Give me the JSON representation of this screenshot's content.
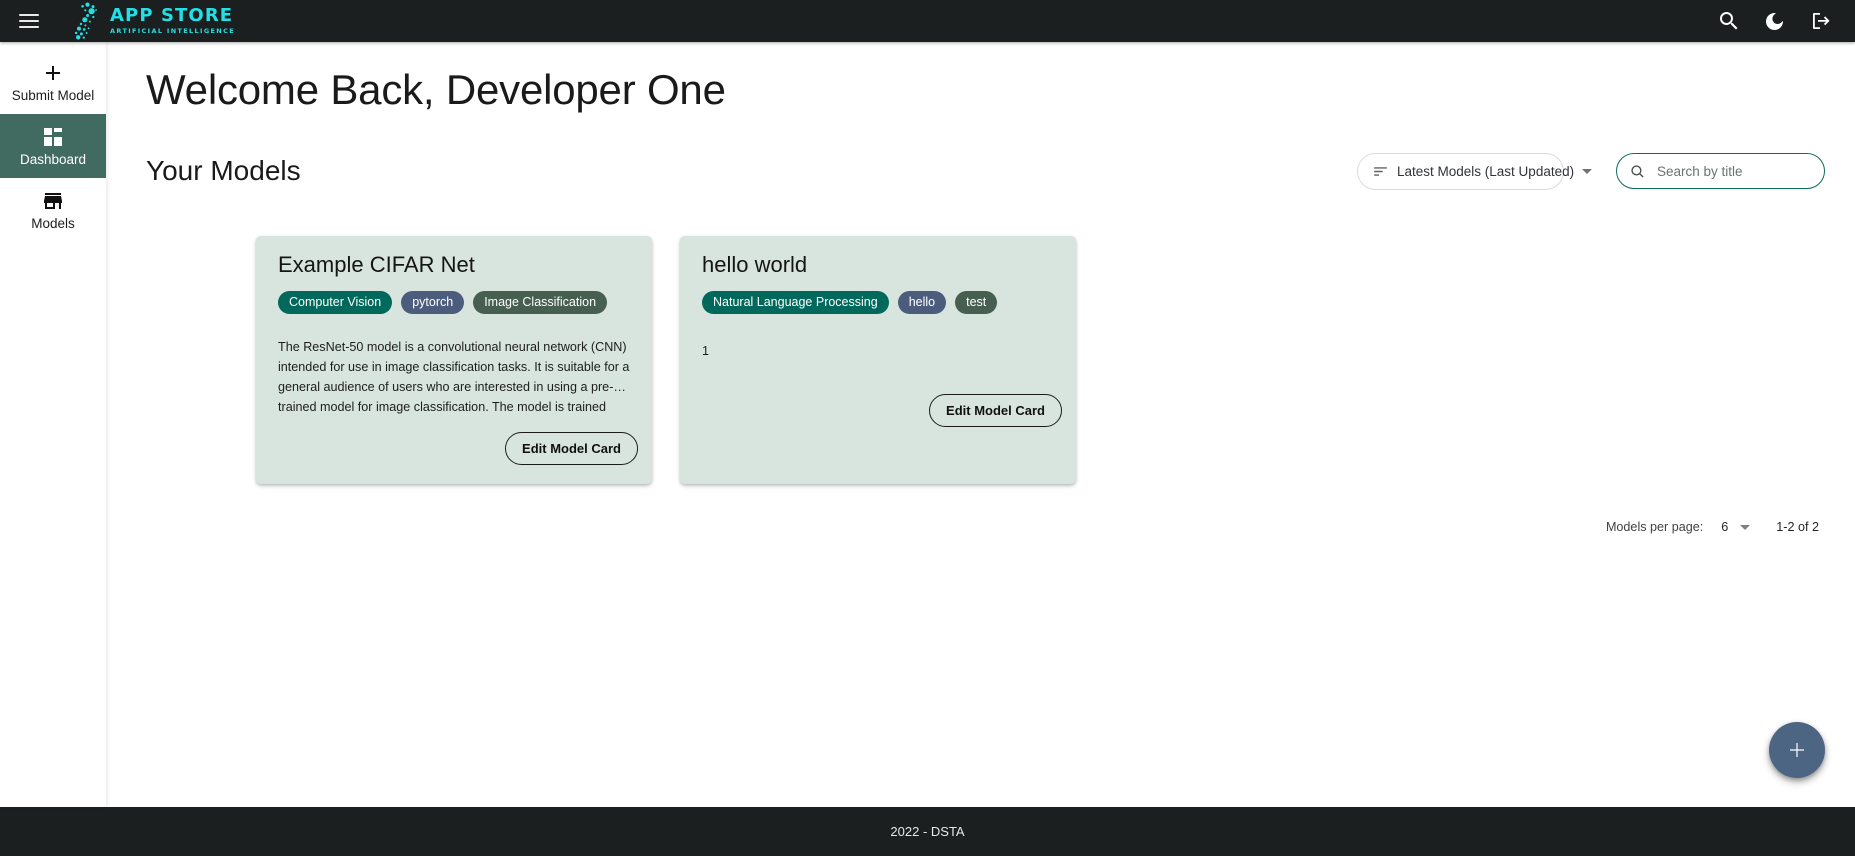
{
  "topbar": {
    "menu_icon": "hamburger-menu-icon",
    "logo": {
      "title": "APP STORE",
      "subtitle": "ARTIFICIAL INTELLIGENCE",
      "mark": "dot-swirl-logo",
      "color": "#22e0e6"
    },
    "actions": [
      {
        "name": "search-icon",
        "label": "Search"
      },
      {
        "name": "dark-mode-icon",
        "label": "Toggle dark mode"
      },
      {
        "name": "logout-icon",
        "label": "Logout"
      }
    ]
  },
  "sidebar": {
    "items": [
      {
        "label": "Submit Model",
        "icon": "plus-icon",
        "active": false
      },
      {
        "label": "Dashboard",
        "icon": "dashboard-grid-icon",
        "active": true
      },
      {
        "label": "Models",
        "icon": "storefront-icon",
        "active": false
      }
    ],
    "active_color": "#416a61"
  },
  "main": {
    "welcome_title": "Welcome Back, Developer One",
    "section_title": "Your Models",
    "sort": {
      "icon": "sort-icon",
      "selected": "Latest Models (Last Updated)",
      "caret": "chevron-down-icon"
    },
    "search": {
      "icon": "search-icon",
      "placeholder": "Search by title",
      "value": "",
      "border_color": "#0f6b5c"
    },
    "cards": [
      {
        "title": "Example CIFAR Net",
        "tags": [
          {
            "label": "Computer Vision",
            "color": "#00695c"
          },
          {
            "label": "pytorch",
            "color": "#4c5c7d"
          },
          {
            "label": "Image Classification",
            "color": "#465f50"
          }
        ],
        "description": "The ResNet-50 model is a convolutional neural network (CNN) intended for use in image classification tasks. It is suitable for a general audience of users who are interested in using a pre-… trained model for image classification. The model is trained",
        "button_label": "Edit Model Card"
      },
      {
        "title": "hello world",
        "tags": [
          {
            "label": "Natural Language Processing",
            "color": "#00695c"
          },
          {
            "label": "hello",
            "color": "#4c5c7d"
          },
          {
            "label": "test",
            "color": "#465f50"
          }
        ],
        "description": "1",
        "button_label": "Edit Model Card"
      }
    ],
    "pagination": {
      "label": "Models per page:",
      "per_page": "6",
      "range": "1-2 of 2"
    },
    "fab": {
      "icon": "plus-icon",
      "label": "Add",
      "color": "#4c6582"
    },
    "card_background": "#d8e5df"
  },
  "footer": {
    "text": "2022 - DSTA"
  }
}
